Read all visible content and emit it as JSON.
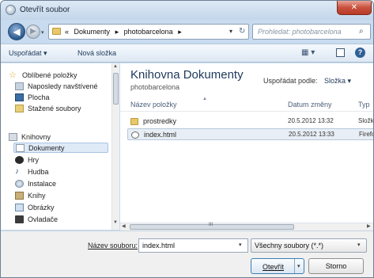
{
  "window": {
    "title": "Otevřít soubor",
    "close_glyph": "✕"
  },
  "address_bar": {
    "overflow": "«",
    "crumbs": [
      "Dokumenty",
      "photobarcelona"
    ],
    "separator": "▸",
    "search_placeholder": "Prohledat: photobarcelona"
  },
  "toolbar": {
    "organize_label": "Uspořádat",
    "new_folder_label": "Nová složka",
    "views_glyph": "▦ ▾",
    "help_glyph": "?"
  },
  "nav": {
    "favorites_label": "Oblíbené položky",
    "recent_label": "Naposledy navštívené",
    "desktop_label": "Plocha",
    "downloads_label": "Stažené soubory",
    "libraries_label": "Knihovny",
    "documents_label": "Dokumenty",
    "games_label": "Hry",
    "music_label": "Hudba",
    "installs_label": "Instalace",
    "books_label": "Knihy",
    "pictures_label": "Obrázky",
    "drivers_label": "Ovladače"
  },
  "content": {
    "library_title": "Knihovna Dokumenty",
    "library_subtitle": "photobarcelona",
    "arrange_label": "Uspořádat podle:",
    "arrange_value": "Složka ▾",
    "columns": {
      "name": "Název položky",
      "date": "Datum změny",
      "type": "Typ"
    },
    "rows": [
      {
        "name": "prostredky",
        "date": "20.5.2012 13:32",
        "type": "Složk",
        "icon": "folder-icon"
      },
      {
        "name": "index.html",
        "date": "20.5.2012 13:33",
        "type": "Firefo",
        "icon": "html-file-icon"
      }
    ],
    "scroll_grip": "III"
  },
  "form": {
    "filename_label": "Název souboru:",
    "filename_value": "index.html",
    "filetype_value": "Všechny soubory (*.*)",
    "open_label": "Otevřít",
    "cancel_label": "Storno"
  }
}
